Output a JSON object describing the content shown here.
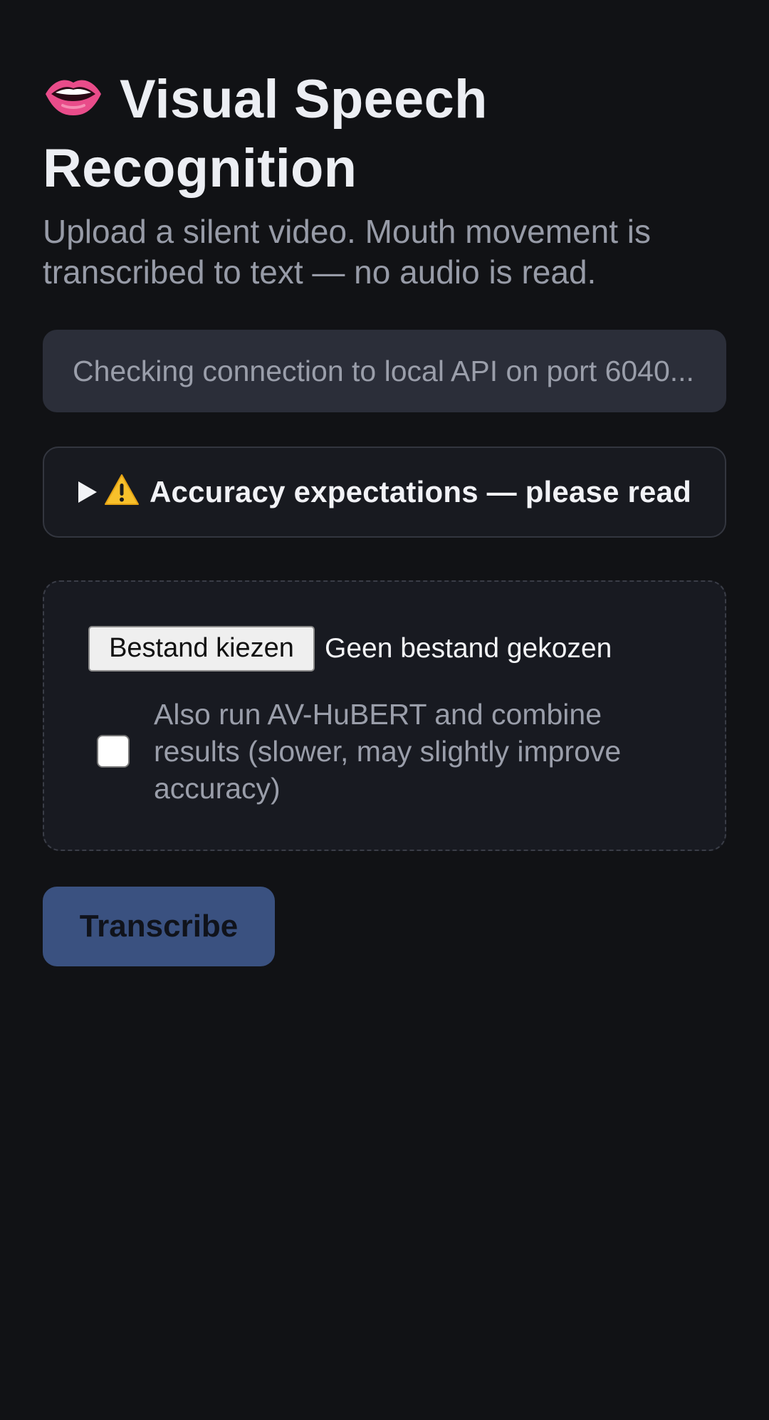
{
  "header": {
    "icon": "lips-icon",
    "title": "Visual Speech Recognition",
    "subtitle": "Upload a silent video. Mouth movement is transcribed to text — no audio is read."
  },
  "status": {
    "text": "Checking connection to local API on port 6040..."
  },
  "accordion": {
    "icon": "warning-icon",
    "label": "Accuracy expectations — please read",
    "expanded": false
  },
  "upload": {
    "button_label": "Bestand kiezen",
    "file_status": "Geen bestand gekozen",
    "checkbox_label": "Also run AV-HuBERT and combine results (slower, may slightly improve accuracy)",
    "checkbox_checked": false
  },
  "actions": {
    "transcribe_label": "Transcribe"
  },
  "colors": {
    "background": "#111215",
    "panel": "#2b2e39",
    "button": "#3a5180",
    "lips": "#e94c8a"
  }
}
